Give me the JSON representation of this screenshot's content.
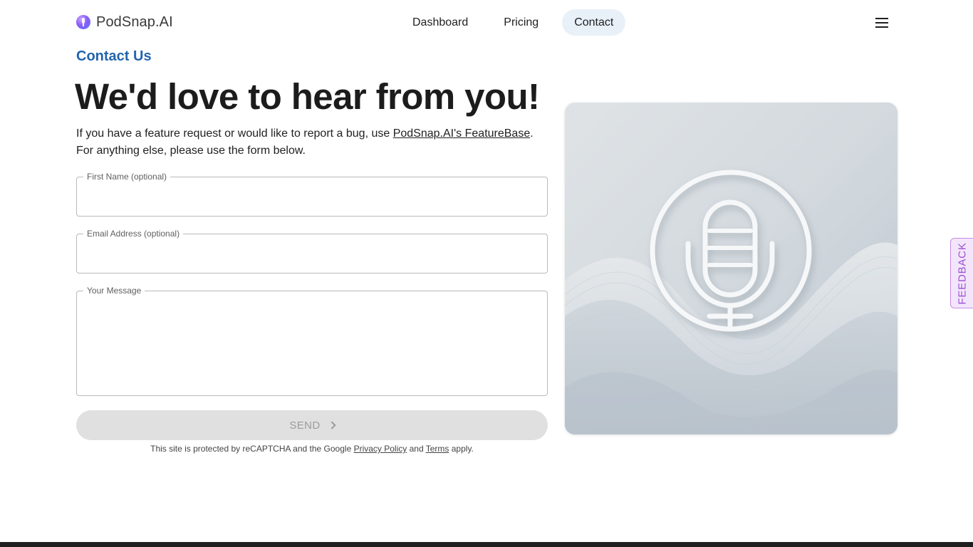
{
  "header": {
    "brand": "PodSnap.AI",
    "nav": [
      {
        "label": "Dashboard",
        "active": false
      },
      {
        "label": "Pricing",
        "active": false
      },
      {
        "label": "Contact",
        "active": true
      }
    ]
  },
  "main": {
    "eyebrow": "Contact Us",
    "headline": "We'd love to hear from you!",
    "intro_before": "If you have a feature request or would like to report a bug, use ",
    "intro_link": "PodSnap.AI's FeatureBase",
    "intro_after": ".",
    "intro_line2": "For anything else, please use the form below."
  },
  "form": {
    "first_name_label": "First Name (optional)",
    "email_label": "Email Address (optional)",
    "message_label": "Your Message",
    "first_name_value": "",
    "email_value": "",
    "message_value": "",
    "send_label": "SEND"
  },
  "recaptcha": {
    "prefix": "This site is protected by reCAPTCHA and the Google ",
    "privacy_label": "Privacy Policy",
    "middle": " and ",
    "terms_label": "Terms",
    "suffix": " apply."
  },
  "feedback_tab": {
    "label": "FEEDBACK"
  },
  "colors": {
    "accent": "#2264ad",
    "active_nav_bg": "#e8f0f8",
    "feedback": "#9b4fd1",
    "button_disabled": "#e0e0e0"
  },
  "icons": [
    "podsnap-logo-icon",
    "hamburger-menu-icon",
    "chevron-right-icon",
    "microphone-illustration"
  ]
}
